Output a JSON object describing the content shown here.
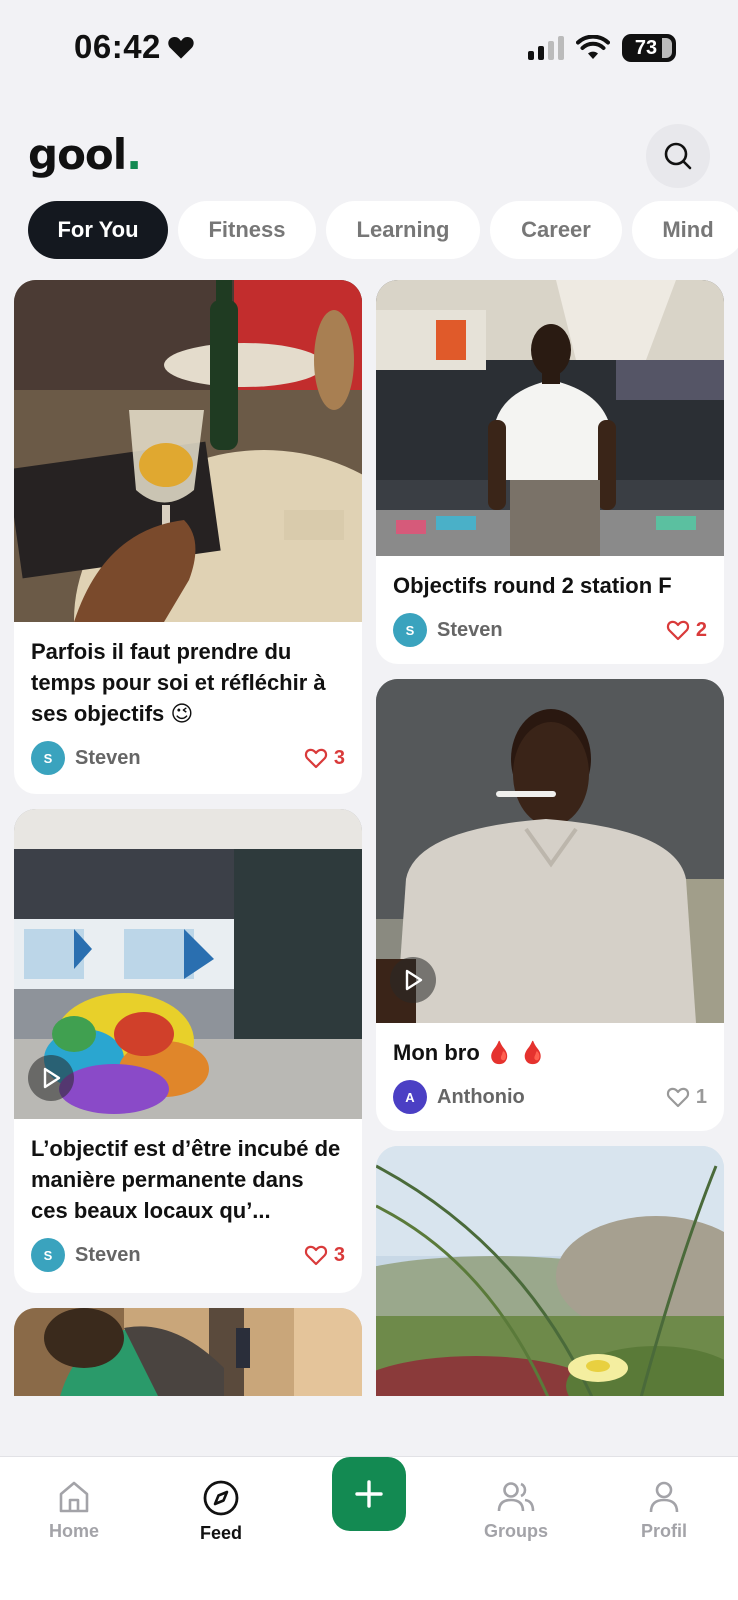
{
  "status_bar": {
    "time": "06:42",
    "battery": "73"
  },
  "header": {
    "logo": "gool",
    "logo_dot": "."
  },
  "tabs": [
    {
      "label": "For You",
      "active": true
    },
    {
      "label": "Fitness"
    },
    {
      "label": "Learning"
    },
    {
      "label": "Career"
    },
    {
      "label": "Mind"
    }
  ],
  "posts": [
    {
      "title": "Parfois il faut prendre du temps pour soi et réfléchir à ses objectifs 😉",
      "author": "Steven",
      "avatar_letter": "S",
      "avatar_color": "#3aa3be",
      "likes": "3",
      "liked": true
    },
    {
      "title": "Objectifs round 2 station F",
      "author": "Steven",
      "avatar_letter": "S",
      "avatar_color": "#3aa3be",
      "likes": "2",
      "liked": true
    },
    {
      "title": "L’objectif est d’être incubé de manière permanente dans ces beaux locaux qu’...",
      "author": "Steven",
      "avatar_letter": "S",
      "avatar_color": "#3aa3be",
      "likes": "3",
      "liked": true,
      "video": true
    },
    {
      "title": "Mon bro 🩸 🩸",
      "author": "Anthonio",
      "avatar_letter": "A",
      "avatar_color": "#4b3fc4",
      "likes": "1",
      "liked": false,
      "video": true
    }
  ],
  "nav": {
    "home": "Home",
    "feed": "Feed",
    "groups": "Groups",
    "profil": "Profil",
    "active": "Feed"
  },
  "colors": {
    "accent": "#138a52",
    "like_red": "#d93a3a",
    "tab_active": "#14181f"
  }
}
